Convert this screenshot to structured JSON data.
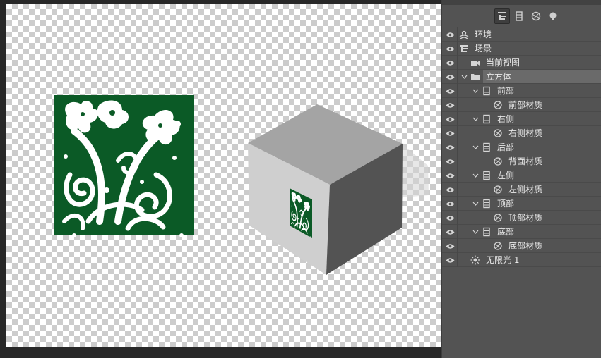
{
  "colors": {
    "panel_bg": "#535353",
    "selected_row": "#6a6a6a",
    "artwork_green": "#0b5a26",
    "text": "#e8e8e8"
  },
  "toolbar": {
    "icons": [
      "scene-icon",
      "mesh-icon",
      "material-icon",
      "light-icon"
    ],
    "active": "scene-icon"
  },
  "layers": [
    {
      "label": "环境",
      "icon": "environment-icon",
      "expanded": null,
      "selected": false
    },
    {
      "label": "场景",
      "icon": "scene-tree-icon",
      "expanded": null,
      "selected": false
    },
    {
      "label": "当前视图",
      "icon": "camera-icon",
      "expanded": null,
      "selected": false
    },
    {
      "label": "立方体",
      "icon": "folder-icon",
      "expanded": true,
      "selected": true
    },
    {
      "label": "前部",
      "icon": "mesh-icon",
      "expanded": true,
      "selected": false
    },
    {
      "label": "前部材质",
      "icon": "material-icon",
      "expanded": null,
      "selected": false
    },
    {
      "label": "右侧",
      "icon": "mesh-icon",
      "expanded": true,
      "selected": false
    },
    {
      "label": "右侧材质",
      "icon": "material-icon",
      "expanded": null,
      "selected": false
    },
    {
      "label": "后部",
      "icon": "mesh-icon",
      "expanded": true,
      "selected": false
    },
    {
      "label": "背面材质",
      "icon": "material-icon",
      "expanded": null,
      "selected": false
    },
    {
      "label": "左侧",
      "icon": "mesh-icon",
      "expanded": true,
      "selected": false
    },
    {
      "label": "左侧材质",
      "icon": "material-icon",
      "expanded": null,
      "selected": false
    },
    {
      "label": "顶部",
      "icon": "mesh-icon",
      "expanded": true,
      "selected": false
    },
    {
      "label": "顶部材质",
      "icon": "material-icon",
      "expanded": null,
      "selected": false
    },
    {
      "label": "底部",
      "icon": "mesh-icon",
      "expanded": true,
      "selected": false
    },
    {
      "label": "底部材质",
      "icon": "material-icon",
      "expanded": null,
      "selected": false
    },
    {
      "label": "无限光 1",
      "icon": "infinite-light-icon",
      "expanded": null,
      "selected": false
    }
  ]
}
